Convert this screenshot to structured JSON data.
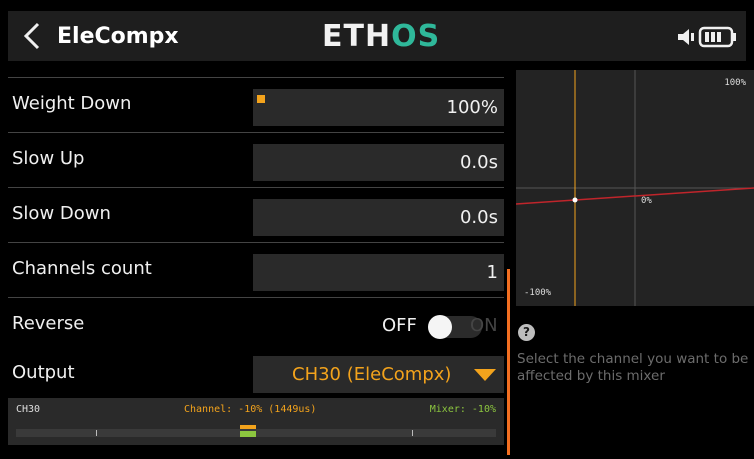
{
  "header": {
    "model_name": "EleCompx",
    "brand_main": "ETH",
    "brand_accent": "OS"
  },
  "fields": [
    {
      "label": "Weight Down",
      "value": "100%"
    },
    {
      "label": "Slow Up",
      "value": "0.0s"
    },
    {
      "label": "Slow Down",
      "value": "0.0s"
    },
    {
      "label": "Channels count",
      "value": "1"
    }
  ],
  "reverse": {
    "label": "Reverse",
    "off_label": "OFF",
    "on_label": "ON",
    "state": "OFF"
  },
  "output": {
    "label": "Output",
    "value": "CH30 (EleCompx)"
  },
  "monitor": {
    "channel_name": "CH30",
    "channel_text": "Channel: -10% (1449us)",
    "mixer_text": "Mixer: -10%"
  },
  "curve": {
    "top_label": "100%",
    "mid_label": "0%",
    "bottom_label": "-100%"
  },
  "help": {
    "icon": "?",
    "line1": "Select the channel you want to be",
    "line2": "affected by this mixer"
  },
  "colors": {
    "accent": "#f3a31c",
    "brand_accent": "#2fb89a",
    "mixer": "#8cc63f",
    "scrollbar": "#f36f21",
    "curve_line": "#c0252b"
  }
}
